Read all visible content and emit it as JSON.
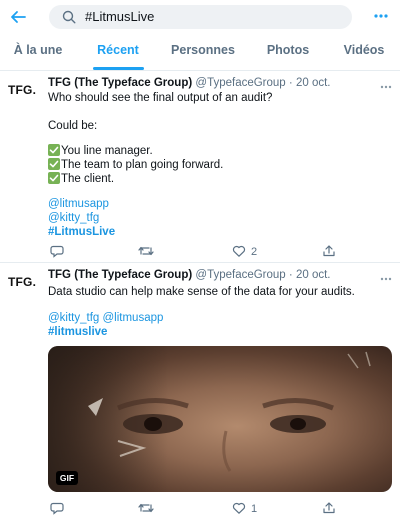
{
  "topbar": {
    "back_icon": "arrow-left-icon",
    "search_query": "#LitmusLive",
    "search_icon": "search-icon",
    "more_icon": "more-horizontal-icon"
  },
  "tabs": [
    {
      "label": "À la une",
      "active": false
    },
    {
      "label": "Récent",
      "active": true
    },
    {
      "label": "Personnes",
      "active": false
    },
    {
      "label": "Photos",
      "active": false
    },
    {
      "label": "Vidéos",
      "active": false
    }
  ],
  "colors": {
    "accent": "#1da1f2",
    "link": "#1b95e0",
    "muted": "#5b7083",
    "check": "#77b255"
  },
  "tweets": [
    {
      "avatar": "TFG.",
      "name": "TFG (The Typeface Group)",
      "handle": "@TypefaceGroup",
      "separator": "·",
      "date": "20 oct.",
      "lines": [
        "Who should see the final output of an audit?",
        "Could be:",
        "You line manager.",
        "The team to plan going forward.",
        "The client.",
        "@litmusapp",
        "@kitty_tfg",
        "#LitmusLive"
      ],
      "check_icon": "check-mark-button-emoji",
      "reply_count": "",
      "retweet_count": "",
      "like_count": "2"
    },
    {
      "avatar": "TFG.",
      "name": "TFG (The Typeface Group)",
      "handle": "@TypefaceGroup",
      "separator": "·",
      "date": "20 oct.",
      "lines": [
        "Data studio can help make sense of the data for your audits.",
        "@kitty_tfg @litmusapp",
        "#litmuslive"
      ],
      "media_badge": "GIF",
      "reply_count": "",
      "retweet_count": "",
      "like_count": "1"
    }
  ]
}
